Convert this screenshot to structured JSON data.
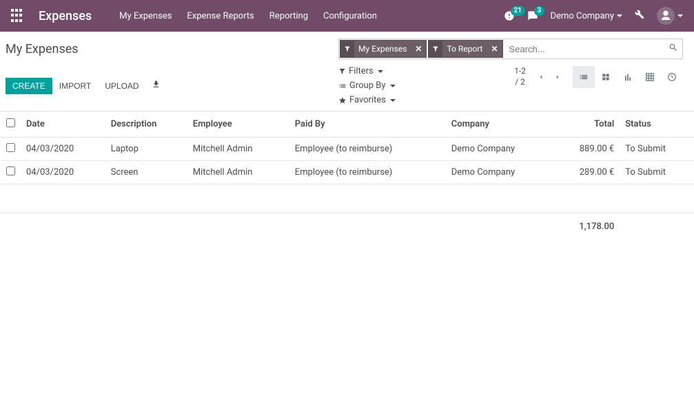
{
  "navbar": {
    "brand": "Expenses",
    "menu": [
      "My Expenses",
      "Expense Reports",
      "Reporting",
      "Configuration"
    ],
    "activity_count": "21",
    "messages_count": "3",
    "company": "Demo Company"
  },
  "control_panel": {
    "title": "My Expenses",
    "facets": [
      {
        "label": "My Expenses"
      },
      {
        "label": "To Report"
      }
    ],
    "search_placeholder": "Search...",
    "buttons": {
      "create": "Create",
      "import": "Import",
      "upload": "Upload"
    },
    "search_options": {
      "filters": "Filters",
      "groupby": "Group By",
      "favorites": "Favorites"
    },
    "pager": {
      "range": "1-2",
      "of": "/ 2"
    }
  },
  "table": {
    "headers": {
      "date": "Date",
      "description": "Description",
      "employee": "Employee",
      "paidby": "Paid By",
      "company": "Company",
      "total": "Total",
      "status": "Status"
    },
    "rows": [
      {
        "date": "04/03/2020",
        "description": "Laptop",
        "employee": "Mitchell Admin",
        "paidby": "Employee (to reimburse)",
        "company": "Demo Company",
        "total": "889.00 €",
        "status": "To Submit"
      },
      {
        "date": "04/03/2020",
        "description": "Screen",
        "employee": "Mitchell Admin",
        "paidby": "Employee (to reimburse)",
        "company": "Demo Company",
        "total": "289.00 €",
        "status": "To Submit"
      }
    ],
    "footer_total": "1,178.00"
  }
}
